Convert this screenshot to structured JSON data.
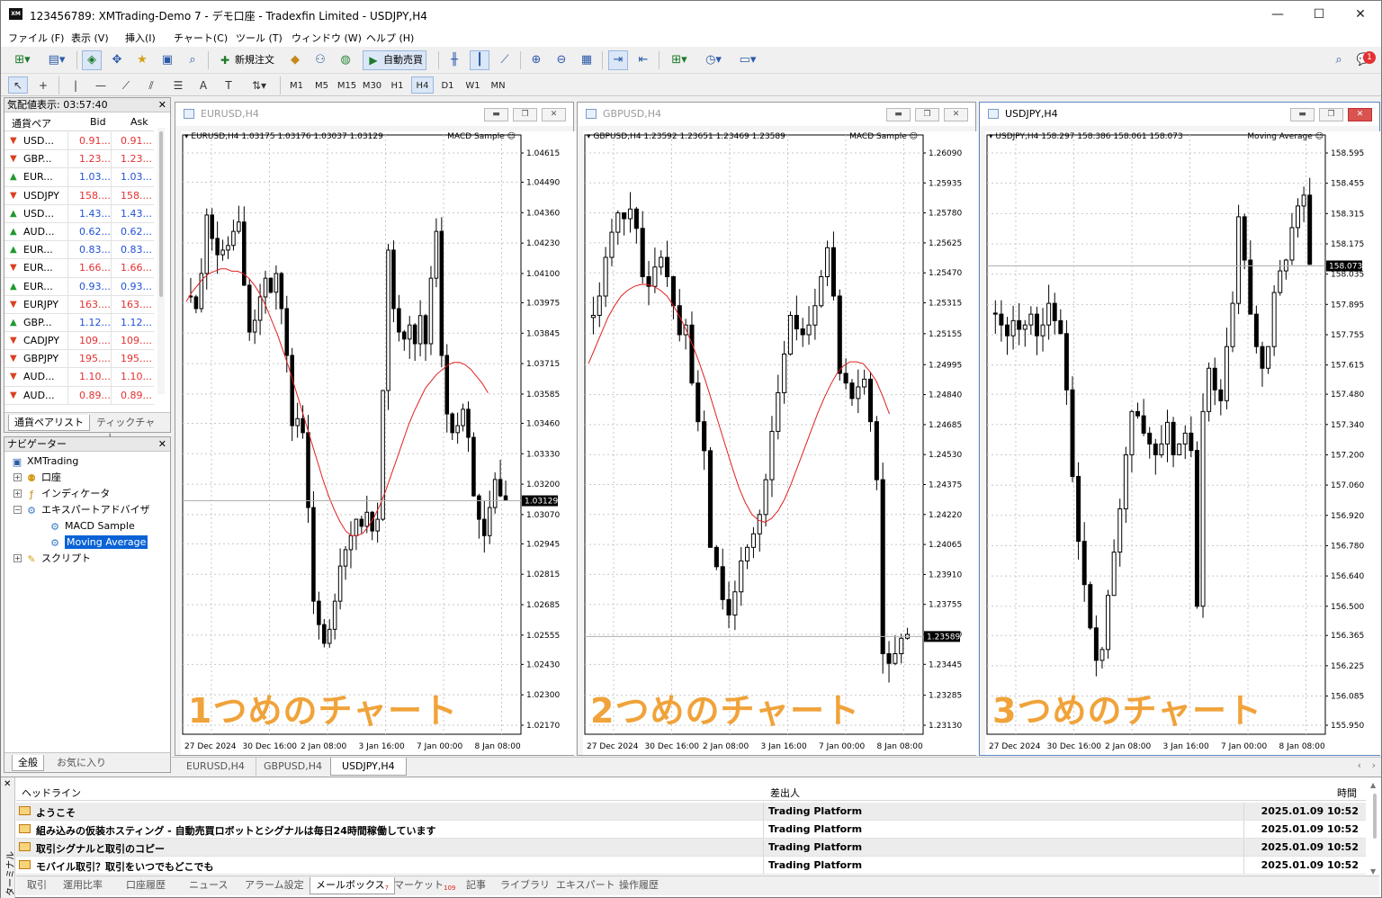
{
  "window": {
    "title": "123456789: XMTrading-Demo 7 - デモ口座 - Tradexfin Limited - USDJPY,H4",
    "app_icon": "XM",
    "minimize": "—",
    "maximize": "☐",
    "close": "✕"
  },
  "menu": [
    "ファイル (F)",
    "表示 (V)",
    "挿入(I)",
    "チャート(C)",
    "ツール (T)",
    "ウィンドウ (W)",
    "ヘルプ (H)"
  ],
  "toolbar": {
    "new_order": "新規注文",
    "auto_trading": "自動売買",
    "notification_count": "1"
  },
  "timeframes": [
    "M1",
    "M5",
    "M15",
    "M30",
    "H1",
    "H4",
    "D1",
    "W1",
    "MN"
  ],
  "active_timeframe": "H4",
  "market_watch": {
    "title": "気配値表示: 03:57:40",
    "col_symbol": "通貨ペア",
    "col_bid": "Bid",
    "col_ask": "Ask",
    "rows": [
      {
        "sym": "USD...",
        "bid": "0.91...",
        "ask": "0.91...",
        "dir": "down"
      },
      {
        "sym": "GBP...",
        "bid": "1.23...",
        "ask": "1.23...",
        "dir": "down"
      },
      {
        "sym": "EUR...",
        "bid": "1.03...",
        "ask": "1.03...",
        "dir": "up"
      },
      {
        "sym": "USDJPY",
        "bid": "158....",
        "ask": "158....",
        "dir": "down"
      },
      {
        "sym": "USD...",
        "bid": "1.43...",
        "ask": "1.43...",
        "dir": "up"
      },
      {
        "sym": "AUD...",
        "bid": "0.62...",
        "ask": "0.62...",
        "dir": "up"
      },
      {
        "sym": "EUR...",
        "bid": "0.83...",
        "ask": "0.83...",
        "dir": "up"
      },
      {
        "sym": "EUR...",
        "bid": "1.66...",
        "ask": "1.66...",
        "dir": "down"
      },
      {
        "sym": "EUR...",
        "bid": "0.93...",
        "ask": "0.93...",
        "dir": "up"
      },
      {
        "sym": "EURJPY",
        "bid": "163....",
        "ask": "163....",
        "dir": "down"
      },
      {
        "sym": "GBP...",
        "bid": "1.12...",
        "ask": "1.12...",
        "dir": "up"
      },
      {
        "sym": "CADJPY",
        "bid": "109....",
        "ask": "109....",
        "dir": "down"
      },
      {
        "sym": "GBPJPY",
        "bid": "195....",
        "ask": "195....",
        "dir": "down"
      },
      {
        "sym": "AUD...",
        "bid": "1.10...",
        "ask": "1.10...",
        "dir": "down"
      },
      {
        "sym": "AUD...",
        "bid": "0.89...",
        "ask": "0.89...",
        "dir": "down"
      }
    ],
    "tabs": [
      "通貨ペアリスト",
      "ティックチャート"
    ]
  },
  "navigator": {
    "title": "ナビゲーター",
    "root": "XMTrading",
    "items": [
      "口座",
      "インディケータ",
      "エキスパートアドバイザ",
      "MACD Sample",
      "Moving Average",
      "スクリプト"
    ],
    "tabs": [
      "全般",
      "お気に入り"
    ]
  },
  "charts": [
    {
      "tab": "EURUSD,H4",
      "window_title": "EURUSD,H4",
      "info": "EURUSD,H4  1.03175 1.03176 1.03037 1.03129",
      "ea": "MACD Sample ☺",
      "current_price": "1.03129",
      "current_value": 1.03129,
      "yticks": [
        "1.04615",
        "1.04490",
        "1.04360",
        "1.04230",
        "1.04100",
        "1.03975",
        "1.03845",
        "1.03715",
        "1.03585",
        "1.03460",
        "1.03330",
        "1.03200",
        "1.03070",
        "1.02945",
        "1.02815",
        "1.02685",
        "1.02555",
        "1.02430",
        "1.02300",
        "1.02170"
      ],
      "ymin": 1.0217,
      "ymax": 1.04615,
      "xticks": [
        "27 Dec 2024",
        "30 Dec 16:00",
        "2 Jan 08:00",
        "3 Jan 16:00",
        "7 Jan 00:00",
        "8 Jan 08:00"
      ],
      "overlay": "1つめのチャート",
      "seed": 11,
      "closes": [
        1.04,
        1.0395,
        1.041,
        1.0435,
        1.0425,
        1.0418,
        1.042,
        1.0422,
        1.0428,
        1.0432,
        1.0405,
        1.0385,
        1.039,
        1.04,
        1.0408,
        1.0402,
        1.041,
        1.0395,
        1.0375,
        1.0345,
        1.0348,
        1.0342,
        1.031,
        1.027,
        1.026,
        1.0252,
        1.0258,
        1.027,
        1.0285,
        1.0292,
        1.0298,
        1.0305,
        1.0302,
        1.0308,
        1.03,
        1.0305,
        1.036,
        1.042,
        1.0395,
        1.0385,
        1.0382,
        1.0388,
        1.038,
        1.0392,
        1.038,
        1.0408,
        1.0428,
        1.0375,
        1.035,
        1.0342,
        1.0345,
        1.0352,
        1.034,
        1.0315,
        1.0305,
        1.0298,
        1.031,
        1.0322,
        1.0315,
        1.0313
      ],
      "ma": [
        1.0398,
        1.0402,
        1.0405,
        1.0408,
        1.041,
        1.0411,
        1.0412,
        1.0412,
        1.0411,
        1.0411,
        1.041,
        1.0408,
        1.0405,
        1.0401,
        1.0396,
        1.039,
        1.0384,
        1.0377,
        1.037,
        1.0362,
        1.0354,
        1.0346,
        1.0338,
        1.033,
        1.0322,
        1.0315,
        1.0309,
        1.0304,
        1.03,
        1.0298,
        1.0298,
        1.0299,
        1.0302,
        1.0306,
        1.0311,
        1.0317,
        1.0324,
        1.0331,
        1.0338,
        1.0345,
        1.0351,
        1.0356,
        1.0361,
        1.0364,
        1.0367,
        1.0369,
        1.0371,
        1.0372,
        1.0372,
        1.0371,
        1.0369,
        1.0366,
        1.0363,
        1.0359
      ]
    },
    {
      "tab": "GBPUSD,H4",
      "window_title": "GBPUSD,H4",
      "info": "GBPUSD,H4  1.23592 1.23651 1.23469 1.23589",
      "ea": "MACD Sample ☺",
      "current_price": "1.23589",
      "current_value": 1.23589,
      "yticks": [
        "1.26090",
        "1.25935",
        "1.25780",
        "1.25625",
        "1.25470",
        "1.25315",
        "1.25155",
        "1.24995",
        "1.24840",
        "1.24685",
        "1.24530",
        "1.24375",
        "1.24220",
        "1.24065",
        "1.23910",
        "1.23755",
        "1.23600",
        "1.23445",
        "1.23285",
        "1.23130"
      ],
      "ymin": 1.2313,
      "ymax": 1.2609,
      "xticks": [
        "27 Dec 2024",
        "30 Dec 16:00",
        "2 Jan 08:00",
        "3 Jan 16:00",
        "7 Jan 00:00",
        "8 Jan 08:00"
      ],
      "overlay": "2つめのチャート",
      "seed": 23,
      "closes": [
        1.2525,
        1.2535,
        1.2555,
        1.2568,
        1.2578,
        1.2575,
        1.258,
        1.257,
        1.2545,
        1.254,
        1.255,
        1.2555,
        1.2545,
        1.253,
        1.2515,
        1.252,
        1.249,
        1.247,
        1.2455,
        1.2405,
        1.2395,
        1.2378,
        1.237,
        1.2382,
        1.2398,
        1.2405,
        1.2412,
        1.2422,
        1.244,
        1.2465,
        1.2485,
        1.2505,
        1.2525,
        1.2518,
        1.2515,
        1.252,
        1.253,
        1.2545,
        1.256,
        1.2535,
        1.2495,
        1.249,
        1.2482,
        1.2488,
        1.2492,
        1.247,
        1.244,
        1.235,
        1.2345,
        1.235,
        1.2358,
        1.236
      ],
      "ma": [
        1.25,
        1.2508,
        1.2516,
        1.2524,
        1.253,
        1.2535,
        1.2538,
        1.254,
        1.2541,
        1.2541,
        1.254,
        1.2538,
        1.2535,
        1.253,
        1.2524,
        1.2517,
        1.2509,
        1.25,
        1.249,
        1.2479,
        1.2468,
        1.2457,
        1.2446,
        1.2436,
        1.2428,
        1.2422,
        1.2419,
        1.2418,
        1.242,
        1.2424,
        1.243,
        1.2438,
        1.2447,
        1.2456,
        1.2465,
        1.2474,
        1.2482,
        1.2489,
        1.2495,
        1.2499,
        1.2501,
        1.2501,
        1.25,
        1.2496,
        1.2491,
        1.2483,
        1.2474
      ]
    },
    {
      "tab": "USDJPY,H4",
      "window_title": "USDJPY,H4",
      "info": "USDJPY,H4  158.297 158.386 158.061 158.073",
      "ea": "Moving Average ☺",
      "current_price": "158.073",
      "current_value": 158.073,
      "yticks": [
        "158.595",
        "158.455",
        "158.315",
        "158.175",
        "158.035",
        "157.895",
        "157.755",
        "157.615",
        "157.480",
        "157.340",
        "157.200",
        "157.060",
        "156.920",
        "156.780",
        "156.640",
        "156.500",
        "156.365",
        "156.225",
        "156.085",
        "155.950"
      ],
      "ymin": 155.95,
      "ymax": 158.595,
      "xticks": [
        "27 Dec 2024",
        "30 Dec 16:00",
        "2 Jan 08:00",
        "3 Jan 16:00",
        "7 Jan 00:00",
        "8 Jan 08:00"
      ],
      "overlay": "3つめのチャート",
      "seed": 37,
      "closes": [
        157.85,
        157.8,
        157.75,
        157.82,
        157.78,
        157.8,
        157.85,
        157.75,
        157.8,
        157.9,
        157.82,
        157.76,
        157.5,
        157.1,
        156.8,
        156.6,
        156.4,
        156.25,
        156.3,
        156.55,
        156.75,
        156.95,
        157.2,
        157.4,
        157.38,
        157.3,
        157.25,
        157.2,
        157.25,
        157.35,
        157.2,
        157.25,
        157.3,
        157.22,
        156.5,
        157.4,
        157.6,
        157.5,
        157.45,
        157.7,
        157.9,
        158.3,
        158.1,
        157.85,
        157.7,
        157.6,
        157.7,
        157.95,
        158.05,
        158.1,
        158.25,
        158.35,
        158.4,
        158.08
      ],
      "ma": []
    }
  ],
  "active_chart": 2,
  "terminal": {
    "side_label": "ターミナル",
    "col_headline": "ヘッドライン",
    "col_from": "差出人",
    "col_time": "時間",
    "rows": [
      {
        "headline": "ようこそ",
        "from": "Trading Platform",
        "time": "2025.01.09 10:52"
      },
      {
        "headline": "組み込みの仮装ホスティング - 自動売買ロボットとシグナルは毎日24時間稼働しています",
        "from": "Trading Platform",
        "time": "2025.01.09 10:52"
      },
      {
        "headline": "取引シグナルと取引のコピー",
        "from": "Trading Platform",
        "time": "2025.01.09 10:52"
      },
      {
        "headline": "モバイル取引？取引をいつでもどこでも",
        "from": "Trading Platform",
        "time": "2025.01.09 10:52"
      }
    ],
    "tabs": [
      {
        "label": "取引",
        "badge": ""
      },
      {
        "label": "運用比率",
        "badge": ""
      },
      {
        "label": "口座履歴",
        "badge": ""
      },
      {
        "label": "ニュース",
        "badge": ""
      },
      {
        "label": "アラーム設定",
        "badge": ""
      },
      {
        "label": "メールボックス",
        "badge": "7"
      },
      {
        "label": "マーケット",
        "badge": "109"
      },
      {
        "label": "記事",
        "badge": ""
      },
      {
        "label": "ライブラリ",
        "badge": ""
      },
      {
        "label": "エキスパート",
        "badge": ""
      },
      {
        "label": "操作履歴",
        "badge": ""
      }
    ],
    "active_tab": 5
  },
  "colors": {
    "up_arrow": "#1e9a2e",
    "down_arrow": "#d9401f",
    "bid_red": "#e53030",
    "ask_blue": "#2050d8",
    "ma_line": "#e02020",
    "overlay_text": "#f0a33a",
    "price_label_bg": "#000000"
  }
}
